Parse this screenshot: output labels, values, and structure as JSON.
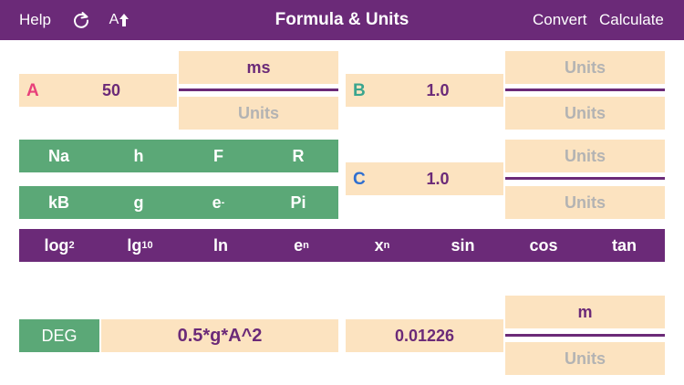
{
  "nav": {
    "help": "Help",
    "reset_icon": "refresh-icon",
    "font_size": "A",
    "font_size_icon": "arrow-up-icon",
    "title": "Formula & Units",
    "convert": "Convert",
    "calculate": "Calculate"
  },
  "variables": {
    "a": {
      "letter": "A",
      "value": "50",
      "unit_top": "ms",
      "unit_bottom": "Units",
      "color": "#e8407a"
    },
    "b": {
      "letter": "B",
      "value": "1.0",
      "unit_top": "Units",
      "unit_bottom": "Units",
      "color": "#3aa58e"
    },
    "c": {
      "letter": "C",
      "value": "1.0",
      "unit_top": "Units",
      "unit_bottom": "Units",
      "color": "#2f6fd0"
    }
  },
  "constants": {
    "row1": [
      "Na",
      "h",
      "F",
      "R"
    ],
    "row2": [
      "kB",
      "g",
      "e",
      "Pi"
    ],
    "e_super": "-"
  },
  "functions": {
    "log2": {
      "base": "log",
      "sub": "2"
    },
    "lg10": {
      "base": "lg",
      "sub": "10"
    },
    "ln": "ln",
    "en": {
      "base": "e",
      "sup": "n"
    },
    "xn": {
      "base": "x",
      "sup": "n"
    },
    "sin": "sin",
    "cos": "cos",
    "tan": "tan"
  },
  "formula": {
    "mode": "DEG",
    "expression": "0.5*g*A^2",
    "result": "0.01226",
    "unit_top": "m",
    "unit_bottom": "Units"
  },
  "colors": {
    "purple": "#6b2a78",
    "green": "#5ba877",
    "cream": "#fce3c0",
    "placeholder": "#b3b3b3"
  }
}
